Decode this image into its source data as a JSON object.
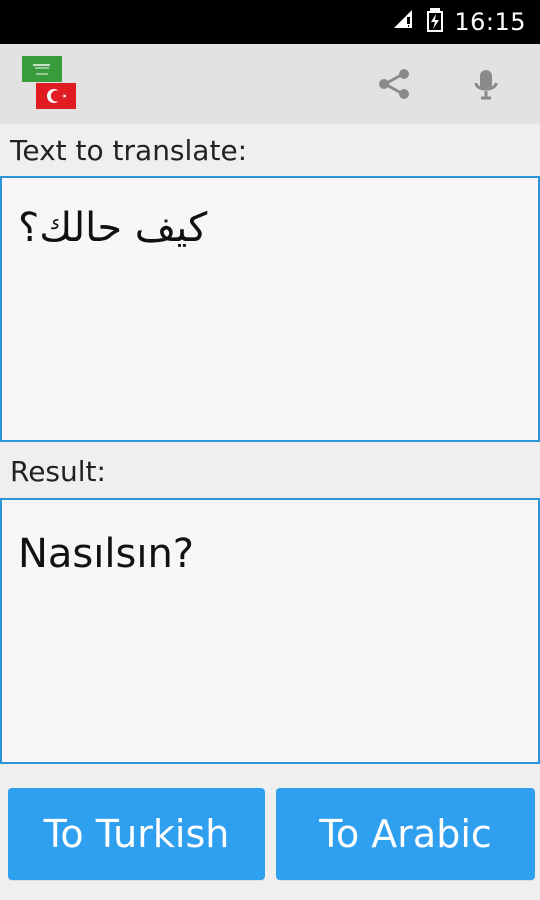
{
  "status_bar": {
    "time": "16:15"
  },
  "app_bar": {
    "language_flags": {
      "top_flag": "Saudi Arabia",
      "bottom_flag": "Turkey"
    },
    "actions": {
      "share_icon": "share-icon",
      "mic_icon": "microphone-icon"
    }
  },
  "content": {
    "input_label": "Text to translate:",
    "input_value": "كيف حالك؟",
    "result_label": "Result:",
    "result_value": "Nasılsın?"
  },
  "buttons": {
    "to_turkish": "To Turkish",
    "to_arabic": "To Arabic"
  },
  "colors": {
    "accent": "#2f9ff0",
    "border": "#2f93d8",
    "background": "#efefef",
    "field": "#f7f7f7",
    "status_bar": "#000000",
    "app_bar": "#e2e2e2",
    "saudi_flag": "#3a9b3a",
    "turkey_flag": "#e11b22"
  }
}
